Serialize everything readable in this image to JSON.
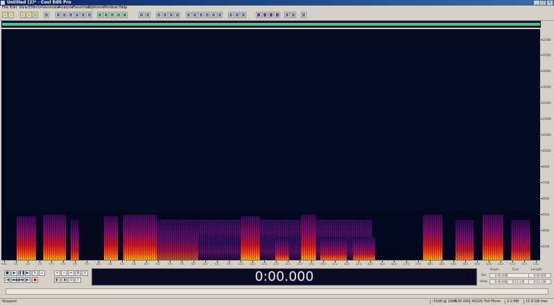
{
  "window": {
    "title": "Untitled (2)* - Cool Edit Pro"
  },
  "menus": [
    "File",
    "Edit",
    "View",
    "Effects",
    "Generate",
    "Analyze",
    "Favorites",
    "Options",
    "Window",
    "Help"
  ],
  "toolbar": {
    "icons": [
      "new-file",
      "open-file",
      "save-file",
      "close-file",
      "waveform-view",
      "multitrack-view",
      "cut",
      "copy",
      "paste",
      "mix-paste",
      "undo",
      "redo",
      "repeat-last",
      "select-all",
      "spectral-view",
      "waveform-display",
      "zoom-in",
      "zoom-out",
      "zoom-full",
      "marker",
      "metronome",
      "snap",
      "cd-player",
      "settings",
      "help"
    ]
  },
  "spectrogram": {
    "y_axis_labels": [
      "21000",
      "19500",
      "18000",
      "16500",
      "15000",
      "13500",
      "12000",
      "10500",
      "9000",
      "7500",
      "6000",
      "4500",
      "3000",
      "1500"
    ],
    "x_axis_labels": [
      "hms",
      "0:5",
      "1:0",
      "1:5",
      "2:0",
      "2:5",
      "3:0",
      "3:5",
      "4:0",
      "4:5",
      "5:0",
      "5:5",
      "6:0",
      "6:5",
      "7:0",
      "7:5",
      "8:0",
      "8:5",
      "9:0",
      "9:5",
      "10:0",
      "10:5",
      "11:0",
      "11:5",
      "12:0",
      "12:5",
      "13:0",
      "13:5",
      "14:0",
      "14:5",
      "15:0",
      "15:5",
      "16:0",
      "16:5",
      "17:0",
      "17:5",
      "18:0",
      "18:5",
      "19:0",
      "19:5",
      "20:0",
      "20:5",
      "21:0",
      "21:5",
      "22:0",
      "hms"
    ]
  },
  "transport": {
    "time_display": "0:00.000",
    "selection": {
      "header_begin": "Begin",
      "header_end": "End",
      "header_length": "Length",
      "row_sel": "Sel",
      "row_view": "View",
      "sel_begin": "0:00.000",
      "sel_end": "",
      "sel_length": "0:00.000",
      "view_begin": "0:00.000",
      "view_end": "0:11.139",
      "view_length": "0:11.139"
    }
  },
  "status": {
    "state": "Stopped",
    "level": "-15dB @ 18dB",
    "position": "0:00.000",
    "format": "44100 ?bit Mono",
    "size": "2.0 MB",
    "free": "15.8 GB free"
  }
}
